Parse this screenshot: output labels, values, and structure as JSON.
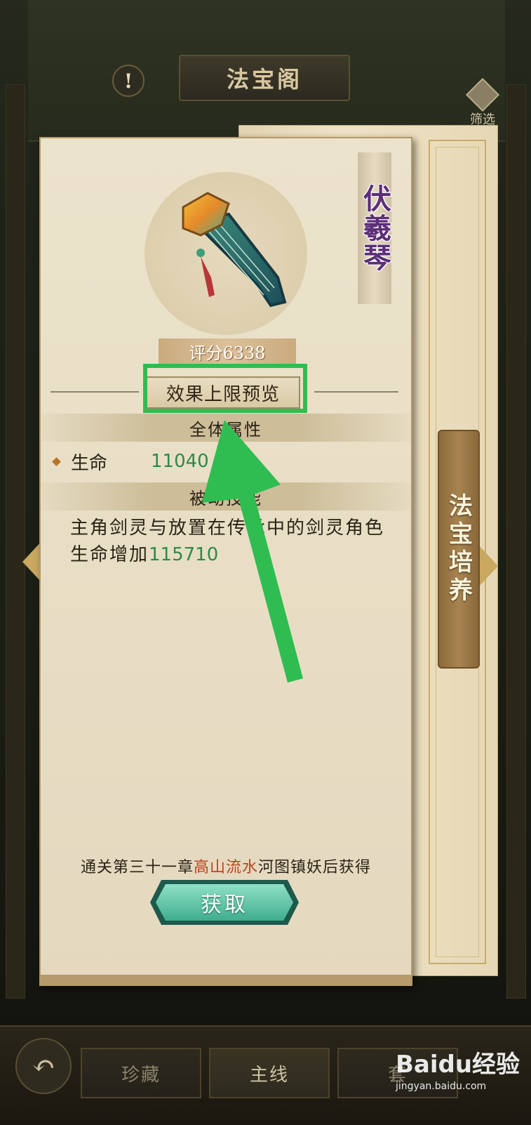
{
  "header": {
    "title": "法宝阁",
    "alert_icon_glyph": "!",
    "filter_label": "筛选"
  },
  "item": {
    "name": "伏羲琴",
    "score": "评分6338",
    "preview_button": "效果上限预览"
  },
  "attributes": {
    "section_title": "全体属性",
    "rows": [
      {
        "label": "生命",
        "value": "11040"
      }
    ]
  },
  "skill": {
    "section_title": "被动技能",
    "description": "主角剑灵与放置在传承中的剑灵角色生命增加",
    "value": "115710"
  },
  "source": {
    "prefix": "通关第三十一章",
    "highlight": "高山流水",
    "suffix": "河图镇妖后获得"
  },
  "get_button": "获取",
  "side_tab": "法宝培养",
  "bottom_nav": {
    "tabs": [
      "珍藏",
      "主线",
      "套"
    ]
  },
  "watermark": {
    "brand": "Baidu经验",
    "url": "jingyan.baidu.com"
  },
  "colors": {
    "highlight_box": "#2fbd52",
    "value_green": "#2c8a4a",
    "source_highlight": "#b7441f",
    "item_name": "#5c2f78"
  }
}
